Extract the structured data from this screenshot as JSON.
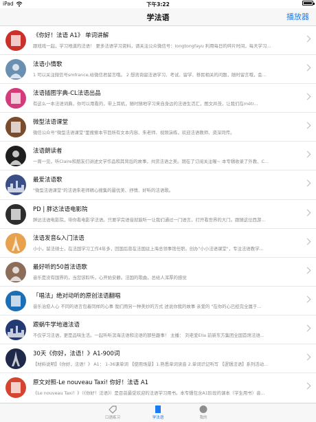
{
  "status": {
    "device": "iPad",
    "time": "下午3:22",
    "battery": ""
  },
  "nav": {
    "title": "学法语",
    "right_label": "播放器"
  },
  "items": [
    {
      "title": "《你好！法语 A1》 单词讲解",
      "desc": "跟戏戏一起，学习地道的法语！ 更多法语学习资料，请关注公众微信号：longtongfayu 利用每日的碎片时间，每天学习...",
      "thumb": "book-icon",
      "color": "#c9312a"
    },
    {
      "title": "法语小情歌",
      "desc": "1 可以关注微信号smfrance,给微信君留言哦。 2 想咨询留法语学习、考试、留学、移民相关的问题，随时留言哦，会...",
      "thumb": "portrait-icon",
      "color": "#6b8fb0"
    },
    {
      "title": "法语插图字典-CL法语出品",
      "desc": "有这么一本法语词典，你可以用看的，带上耳机，随时随地学习来自身边的法语生活汇，图文并茂，让我们在métr...",
      "thumb": "dictionary-icon",
      "color": "#d33b7a"
    },
    {
      "title": "微型法语课堂",
      "desc": "微信公众号\"微型法语课堂\"里搜索本节目所有文本内容、朱老师、视频演练，欢迎法语教师、资深同传。",
      "thumb": "classroom-icon",
      "color": "#7a4b2c"
    },
    {
      "title": "法语朗读者",
      "desc": "一周一见，听Claire和朋友们讲述文学作品和其背后的故事，共赏法语之美。期在了订阅关注喔~ 本专辑收录了外教、C...",
      "thumb": "reader-icon",
      "color": "#1e1e1e"
    },
    {
      "title": "最爱法语歌",
      "desc": "\"微型法语课堂\"的法语朱老师精心搜集的最优美、抒情、好听的法语歌。",
      "thumb": "city-icon",
      "color": "#3b4f86"
    },
    {
      "title": "PD | 胖达法语电影院",
      "desc": "胖达法语电影院，带你看电影学法语。只要学完语音就能听一让我们通过一门语言，打开看世界的大门。跟随这位西游...",
      "thumb": "cinema-icon",
      "color": "#2d2d2d"
    },
    {
      "title": "法语发音&入门法语",
      "desc": "小小，留法硕士，在法国学习工作4年多，回国后曾在法国驻上海总领事馆任职。创办\"小小法语课堂\"，专注法语教学...",
      "thumb": "eiffel-icon",
      "color": "#e8a24d"
    },
    {
      "title": "最好听的50首法语歌",
      "desc": "音乐是没有国界的，当您该聆听，心开始安静。法国的歌曲，总给人浑厚的感觉",
      "thumb": "singer-icon",
      "color": "#8c6d5a"
    },
    {
      "title": "「唱法」绝对动听的原创法语翻唱",
      "desc": "音乐治愈人心 不同的语言包着同样的心事 我们用另一种美妙的方式 述说你我的故事 亲爱的 \"在你的心已经完全属于...",
      "thumb": "sing-logo-icon",
      "color": "#1b6fb5"
    },
    {
      "title": "跟蜗牛学地道法语",
      "desc": "不仅学习法语，更是品味生活。一起听听滨海法语和法语的那些趣事！ 主播： 刘老爱Ella 前新东方集团全国首席法语...",
      "thumb": "paris-night-icon",
      "color": "#233a74"
    },
    {
      "title": "30天《你好，法语！》A1-900词",
      "desc": "【材料说明】《你好，法语！》 A1： 1-36课单词 【使用场景】1.熟悉单词读音 2.单词识记听写 【逻辑法语】系列活动...",
      "thumb": "eiffel-dark-icon",
      "color": "#1f2a4a"
    },
    {
      "title": "原文对照-Le nouveau Taxi! 你好！法语 A1",
      "desc": "《Le nouveau Taxi！》（《你好！法语》）是目前最受欢迎的法语学习用书。本专辑包含A1阶段的课本（学生用书）音...",
      "thumb": "taxi-book-icon",
      "color": "#d5442f"
    }
  ],
  "tabs": [
    {
      "label": "口语练习",
      "icon": "tag-icon",
      "active": false
    },
    {
      "label": "学法语",
      "icon": "book-tab-icon",
      "active": true
    },
    {
      "label": "我的",
      "icon": "profile-icon",
      "active": false
    }
  ]
}
